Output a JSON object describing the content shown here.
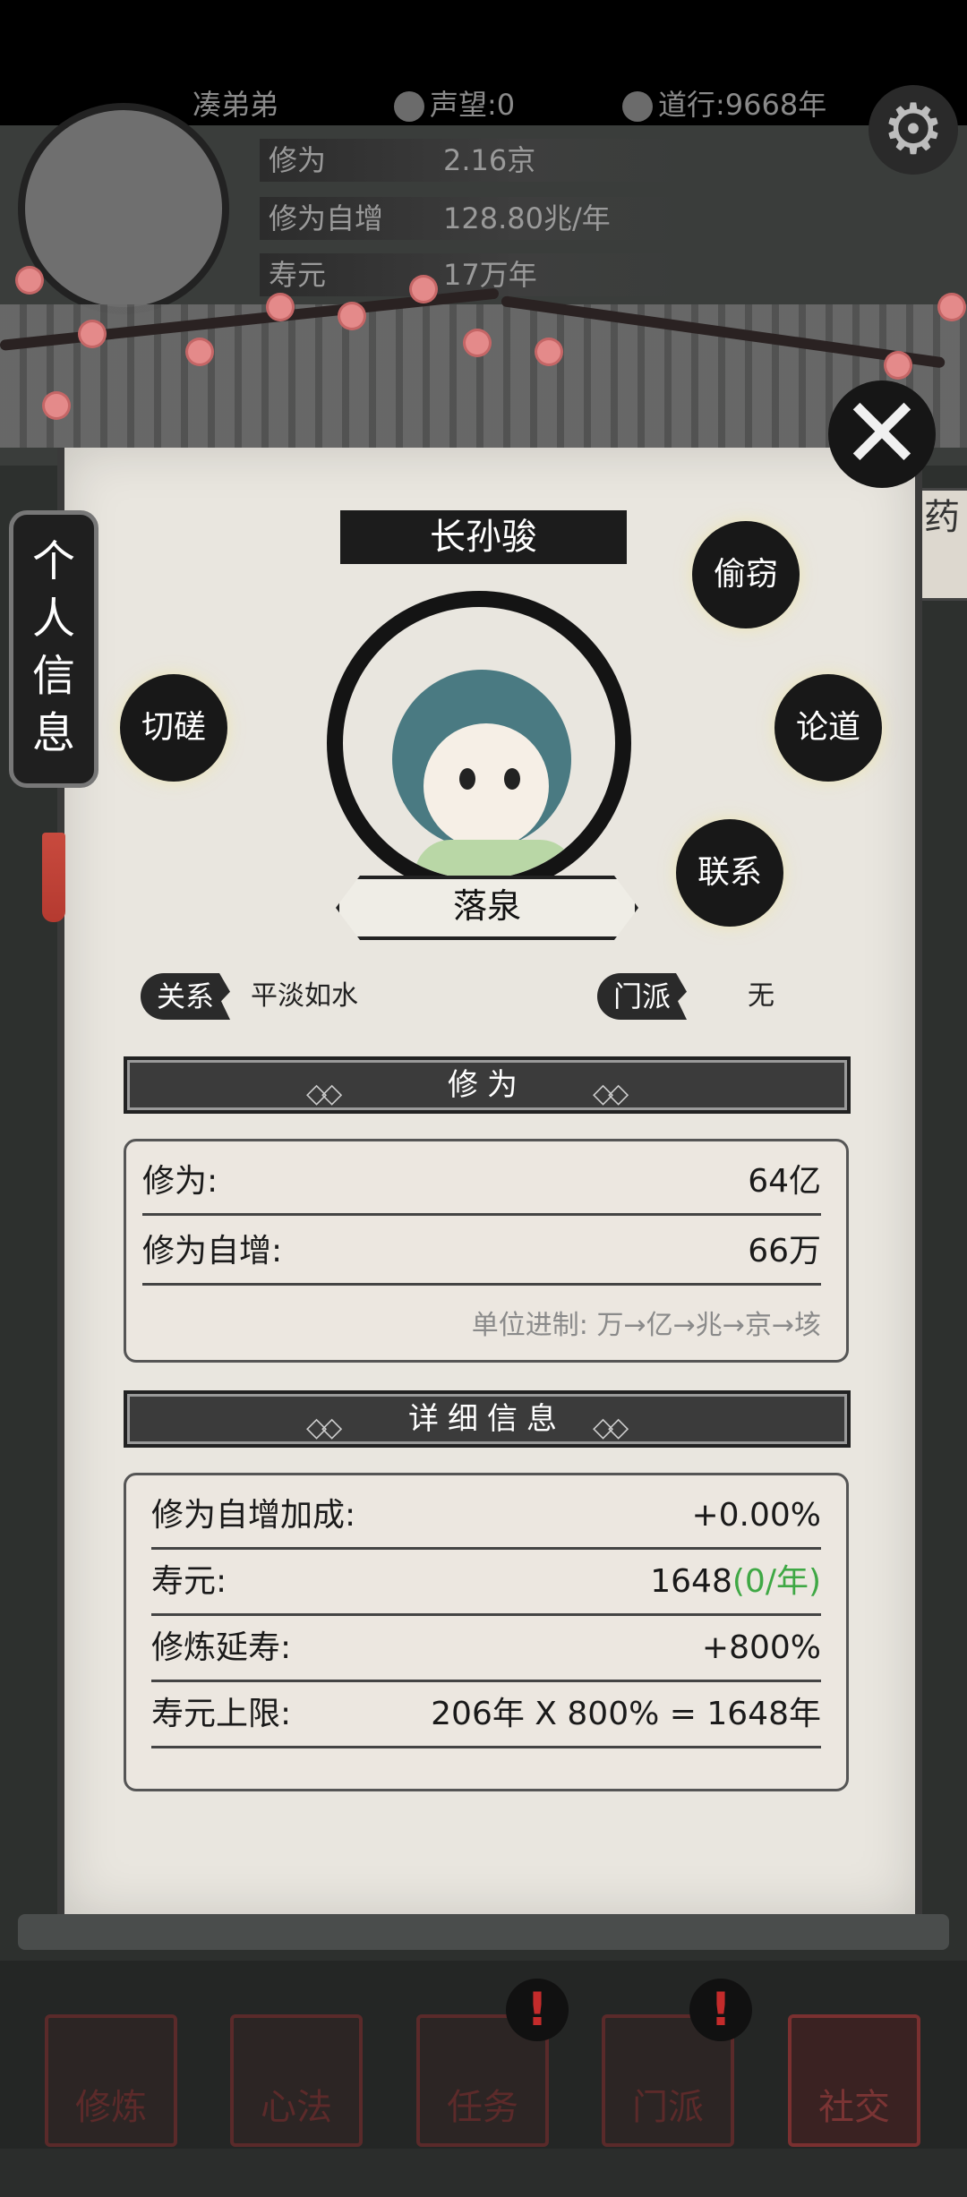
{
  "header": {
    "player_name": "凑弟弟",
    "reputation": "声望:0",
    "dao_years": "道行:9668年",
    "stats": [
      {
        "label": "修为",
        "value": "2.16京"
      },
      {
        "label": "修为自增",
        "value": "128.80兆/年"
      },
      {
        "label": "寿元",
        "value": "17万年"
      }
    ]
  },
  "dialog": {
    "side_tab": "个人信息",
    "npc_name": "长孙骏",
    "sect_place": "落泉",
    "actions": {
      "spar": "切磋",
      "steal": "偷窃",
      "discuss": "论道",
      "contact": "联系"
    },
    "relation_label": "关系",
    "relation_value": "平淡如水",
    "sect_label": "门派",
    "sect_value": "无",
    "cultivation": {
      "title": "修为",
      "rows": [
        {
          "label": "修为:",
          "value": "64亿"
        },
        {
          "label": "修为自增:",
          "value": "66万"
        }
      ],
      "unit_note": "单位进制: 万→亿→兆→京→垓"
    },
    "details": {
      "title": "详细信息",
      "rows": [
        {
          "label": "修为自增加成:",
          "value": "+0.00%"
        },
        {
          "label": "寿元:",
          "value": "1648",
          "value_extra": "(0/年)"
        },
        {
          "label": "修炼延寿:",
          "value": "+800%"
        },
        {
          "label": "寿元上限:",
          "value": "206年 X 800% = 1648年"
        }
      ]
    }
  },
  "peek_text": "药",
  "bottom_nav": [
    {
      "label": "修炼"
    },
    {
      "label": "心法"
    },
    {
      "label": "任务"
    },
    {
      "label": "门派"
    },
    {
      "label": "社交"
    }
  ],
  "alert_glyph": "!",
  "colors": {
    "accent_green": "#3fa845",
    "ink": "#181818",
    "paper": "#e9e6df"
  }
}
